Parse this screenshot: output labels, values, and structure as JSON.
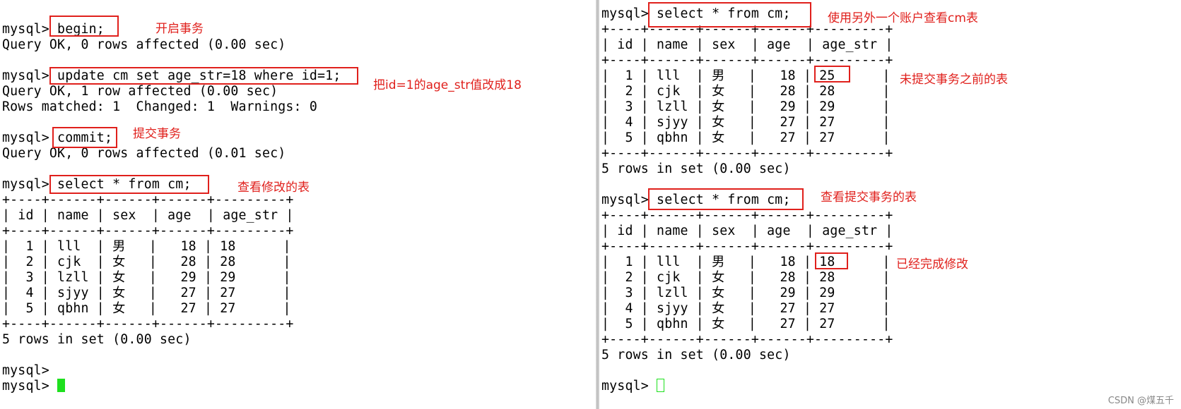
{
  "left_terminal": {
    "lines": [
      "mysql> begin;",
      "Query OK, 0 rows affected (0.00 sec)",
      "",
      "mysql> update cm set age_str=18 where id=1;",
      "Query OK, 1 row affected (0.00 sec)",
      "Rows matched: 1  Changed: 1  Warnings: 0",
      "",
      "mysql> commit;",
      "Query OK, 0 rows affected (0.01 sec)",
      "",
      "mysql> select * from cm;",
      "+----+------+------+------+---------+",
      "| id | name | sex  | age  | age_str |",
      "+----+------+------+------+---------+",
      "|  1 | lll  | 男   |   18 | 18      |",
      "|  2 | cjk  | 女   |   28 | 28      |",
      "|  3 | lzll | 女   |   29 | 29      |",
      "|  4 | sjyy | 女   |   27 | 27      |",
      "|  5 | qbhn | 女   |   27 | 27      |",
      "+----+------+------+------+---------+",
      "5 rows in set (0.00 sec)",
      "",
      "mysql> ",
      "mysql> "
    ],
    "annotations": {
      "begin": "开启事务",
      "update": "把id=1的age_str值改成18",
      "commit": "提交事务",
      "select": "查看修改的表"
    }
  },
  "right_terminal": {
    "lines": [
      "mysql> select * from cm;",
      "+----+------+------+------+---------+",
      "| id | name | sex  | age  | age_str |",
      "+----+------+------+------+---------+",
      "|  1 | lll  | 男   |   18 | 25      |",
      "|  2 | cjk  | 女   |   28 | 28      |",
      "|  3 | lzll | 女   |   29 | 29      |",
      "|  4 | sjyy | 女   |   27 | 27      |",
      "|  5 | qbhn | 女   |   27 | 27      |",
      "+----+------+------+------+---------+",
      "5 rows in set (0.00 sec)",
      "",
      "mysql> select * from cm;",
      "+----+------+------+------+---------+",
      "| id | name | sex  | age  | age_str |",
      "+----+------+------+------+---------+",
      "|  1 | lll  | 男   |   18 | 18      |",
      "|  2 | cjk  | 女   |   28 | 28      |",
      "|  3 | lzll | 女   |   29 | 29      |",
      "|  4 | sjyy | 女   |   27 | 27      |",
      "|  5 | qbhn | 女   |   27 | 27      |",
      "+----+------+------+------+---------+",
      "5 rows in set (0.00 sec)",
      "",
      "mysql> "
    ],
    "annotations": {
      "first_select": "使用另外一个账户查看cm表",
      "before_commit": "未提交事务之前的表",
      "second_select": "查看提交事务的表",
      "after_commit": "已经完成修改"
    }
  },
  "colors": {
    "annotation": "#e0201c",
    "cursor": "#1ee01e",
    "text": "#000000"
  },
  "watermark": "CSDN @煤五千"
}
